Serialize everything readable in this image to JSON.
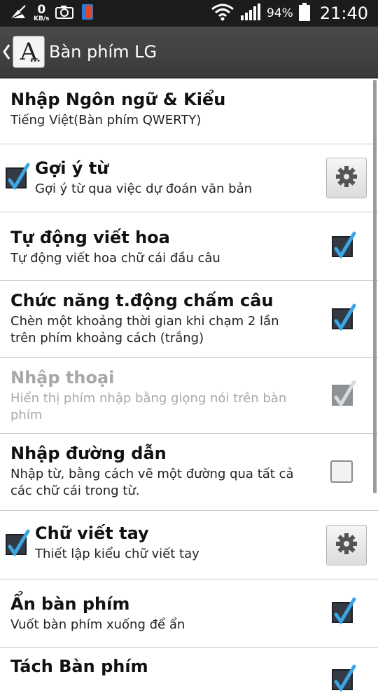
{
  "status_bar": {
    "data_rate": "0",
    "data_unit": "KB/s",
    "battery_percent": "94%",
    "time": "21:40"
  },
  "action_bar": {
    "app_icon_letter": "A",
    "title": "Bàn phím LG"
  },
  "settings": [
    {
      "title": "Nhập Ngôn ngữ & Kiểu",
      "summary": "Tiếng Việt(Bàn phím QWERTY)"
    },
    {
      "title": "Gợi ý từ",
      "summary": "Gợi ý từ qua việc dự đoán văn bản",
      "checked": true,
      "settings_icon": "gear-icon"
    },
    {
      "title": "Tự động viết hoa",
      "summary": "Tự động viết hoa chữ cái đầu câu",
      "checked": true
    },
    {
      "title": "Chức năng t.động chấm câu",
      "summary_line1": "Chèn một khoảng thời gian khi chạm 2 lần",
      "summary_line2": "trên phím khoảng cách (trắng)",
      "checked": true
    },
    {
      "title": "Nhập thoại",
      "summary_line1": "Hiển thị phím nhập bằng giọng nói trên bàn",
      "summary_line2": "phím",
      "checked": true,
      "enabled": false
    },
    {
      "title": "Nhập đường dẫn",
      "summary_line1": "Nhập từ, bằng cách vẽ một đường qua tất cả",
      "summary_line2": "các chữ cái trong từ.",
      "checked": false
    },
    {
      "title": "Chữ viết tay",
      "summary": "Thiết lập kiểu chữ viết tay",
      "checked": true,
      "settings_icon": "gear-icon"
    },
    {
      "title": "Ẩn bàn phím",
      "summary": "Vuốt bàn phím xuống để ẩn",
      "checked": true
    },
    {
      "title": "Tách Bàn phím",
      "checked": true
    }
  ]
}
